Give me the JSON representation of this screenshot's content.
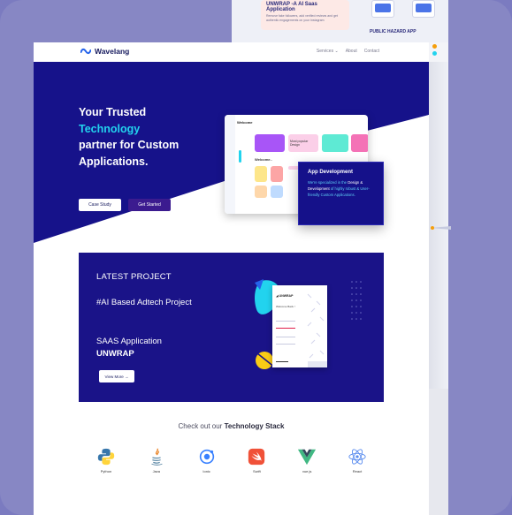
{
  "background_mockup": {
    "card_title": "UNWRAP -A AI Saas Application",
    "card_desc": "Remove fake followers, add verified reviews and get authentic engagements on your Instagram",
    "app_label": "PUBLIC HAZARD APP"
  },
  "brand": {
    "name": "Wavelang",
    "accent": "#22d3ee",
    "primary": "#16128a"
  },
  "nav": {
    "services": "Services",
    "about": "About",
    "contact": "Contact"
  },
  "hero": {
    "line1": "Your Trusted",
    "line2": "Technology",
    "line3": "partner for Custom",
    "line4": "Applications.",
    "btn_case": "Case Study",
    "btn_start": "Get Started"
  },
  "laptop": {
    "header": "Welcome",
    "tile_label": "Most popular Design",
    "sub_header": "Welcome.."
  },
  "app_card": {
    "title": "App Development",
    "desc_a": "We're specialized in the",
    "desc_b": "Design & Development",
    "desc_c": "of highly robust & User-friendly Custom Applications."
  },
  "project": {
    "label": "LATEST PROJECT",
    "ai": "#AI Based Adtech Project",
    "saas": "SAAS Application",
    "saas_name": "UNWRAP",
    "view_more": "View More →",
    "screen_brand": "UNWRAP",
    "screen_welcome": "Welcome Back !"
  },
  "tech": {
    "title_pre": "Check out our",
    "title_bold": "Technology Stack",
    "items": [
      {
        "label": "Python",
        "icon": "python-icon"
      },
      {
        "label": "Java",
        "icon": "java-icon"
      },
      {
        "label": "Ionic",
        "icon": "ionic-icon"
      },
      {
        "label": "Swift",
        "icon": "swift-icon"
      },
      {
        "label": "vue.js",
        "icon": "vue-icon"
      },
      {
        "label": "React",
        "icon": "react-icon"
      }
    ]
  }
}
